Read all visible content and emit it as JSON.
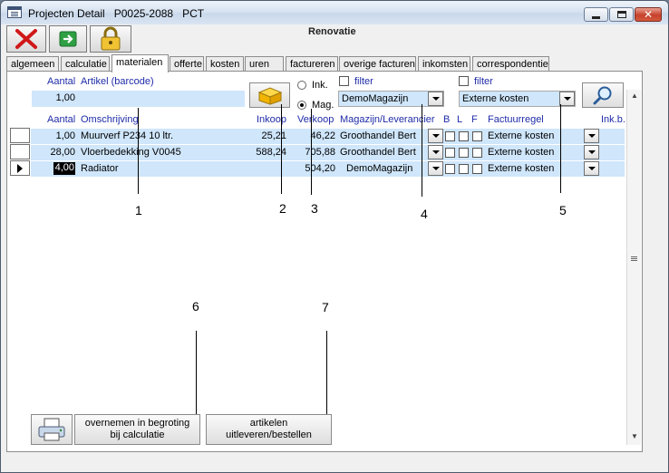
{
  "window": {
    "title": "Projecten Detail   P0025-2088   PCT"
  },
  "toolbar": {
    "project_name": "Renovatie"
  },
  "tabs": [
    {
      "label": "algemeen"
    },
    {
      "label": "calculatie"
    },
    {
      "label": "materialen",
      "active": true
    },
    {
      "label": "offerte"
    },
    {
      "label": "kosten"
    },
    {
      "label": "uren"
    },
    {
      "label": "factureren"
    },
    {
      "label": "overige facturen"
    },
    {
      "label": "inkomsten"
    },
    {
      "label": "correspondentie"
    }
  ],
  "entry": {
    "aantal_label": "Aantal",
    "artikel_label": "Artikel (barcode)",
    "aantal_value": "1,00",
    "artikel_value": "",
    "radio_ink": "Ink.",
    "radio_mag": "Mag.",
    "selected_radio": "Mag.",
    "filter1_label": "filter",
    "filter2_label": "filter",
    "magazijn_value": "DemoMagazijn",
    "factuurregel_value": "Externe kosten"
  },
  "table": {
    "headers": {
      "aantal": "Aantal",
      "omschrijving": "Omschrijving",
      "inkoop": "Inkoop",
      "verkoop": "Verkoop",
      "magazijn": "Magazijn/Leverancier",
      "b": "B",
      "l": "L",
      "f": "F",
      "factuurregel": "Factuurregel",
      "inkb": "Ink.b."
    },
    "rows": [
      {
        "aantal": "1,00",
        "omschrijving": "Muurverf P234 10 ltr.",
        "inkoop": "25,21",
        "verkoop": "46,22",
        "magazijn": "Groothandel Bert",
        "factuurregel": "Externe kosten",
        "current": false
      },
      {
        "aantal": "28,00",
        "omschrijving": "Vloerbedekking V0045",
        "inkoop": "588,24",
        "verkoop": "705,88",
        "magazijn": "Groothandel Bert",
        "factuurregel": "Externe kosten",
        "current": false
      },
      {
        "aantal": "4,00",
        "omschrijving": "Radiator",
        "inkoop": "",
        "verkoop": "504,20",
        "magazijn": "DemoMagazijn",
        "factuurregel": "Externe kosten",
        "current": true
      }
    ]
  },
  "buttons": {
    "overnemen_line1": "overnemen in begroting",
    "overnemen_line2": "bij calculatie",
    "uitleveren_line1": "artikelen",
    "uitleveren_line2": "uitleveren/bestellen"
  },
  "callouts": [
    "1",
    "2",
    "3",
    "4",
    "5",
    "6",
    "7"
  ],
  "colors": {
    "highlight": "#cfe6fb",
    "label_blue": "#1f2ba8"
  }
}
